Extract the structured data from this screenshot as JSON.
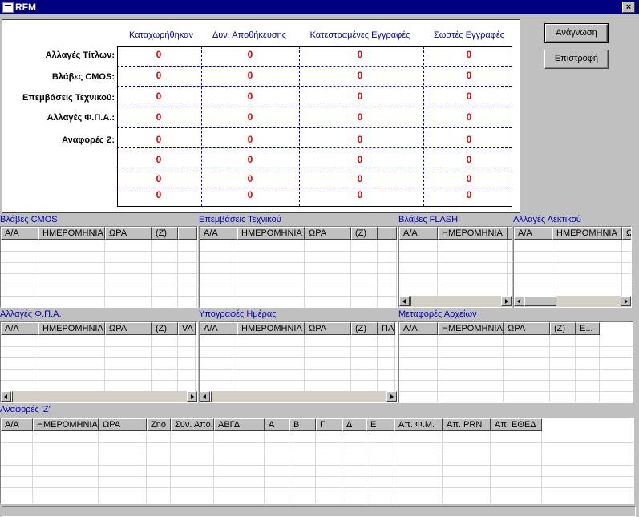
{
  "window": {
    "title": "RFM",
    "close_label": "×"
  },
  "summary": {
    "columns": [
      "Καταχωρήθηκαν",
      "Δυν. Αποθήκευσης",
      "Κατεστραμένες Εγγραφές",
      "Σωστές Εγγραφές"
    ],
    "row_labels": [
      "Αλλαγές Τίτλων:",
      "Βλάβες CMOS:",
      "Επεμβάσεις Τεχνικού:",
      "Αλλαγές Φ.Π.Α.:",
      "Αναφορές Ζ:"
    ],
    "values": [
      [
        "0",
        "0",
        "0",
        "0"
      ],
      [
        "0",
        "0",
        "0",
        "0"
      ],
      [
        "0",
        "0",
        "0",
        "0"
      ],
      [
        "0",
        "0",
        "0",
        "0"
      ],
      [
        "0",
        "0",
        "0",
        "0"
      ],
      [
        "0",
        "0",
        "0",
        "0"
      ],
      [
        "0",
        "0",
        "0",
        "0"
      ],
      [
        "0",
        "0",
        "0",
        "0"
      ]
    ]
  },
  "buttons": {
    "read": "Ανάγνωση",
    "back": "Επιστροφή"
  },
  "grids": {
    "cmos": {
      "label": "Βλάβες CMOS",
      "columns": [
        "Α/Α",
        "ΗΜΕΡΟΜΗΝΙΑ",
        "ΩΡΑ",
        "(Ζ)",
        ""
      ]
    },
    "technician": {
      "label": "Επεμβάσεις Τεχνικού",
      "columns": [
        "Α/Α",
        "ΗΜΕΡΟΜΗΝΙΑ",
        "ΩΡΑ",
        "(Ζ)",
        ""
      ]
    },
    "flash": {
      "label": "Βλάβες FLASH",
      "columns": [
        "Α/Α",
        "ΗΜΕΡΟΜΗΝΙΑ",
        "Ω"
      ]
    },
    "lexicon": {
      "label": "Αλλαγές Λεκτικού",
      "columns": [
        "Α/Α",
        "ΗΜΕΡΟΜΗΝΙΑ",
        "Ω"
      ]
    },
    "vat": {
      "label": "Αλλαγές Φ.Π.Α.",
      "columns": [
        "Α/Α",
        "ΗΜΕΡΟΜΗΝΙΑ",
        "ΩΡΑ",
        "(Ζ)",
        "VA"
      ]
    },
    "signatures": {
      "label": "Υπογραφές Ημέρας",
      "columns": [
        "Α/Α",
        "ΗΜΕΡΟΜΗΝΙΑ",
        "ΩΡΑ",
        "(Ζ)",
        "ΠΑ"
      ]
    },
    "transfers": {
      "label": "Μεταφορές Αρχείων",
      "columns": [
        "Α/Α",
        "ΗΜΕΡΟΜΗΝΙΑ",
        "ΩΡΑ",
        "(Ζ)",
        "Ε..."
      ]
    },
    "zreports": {
      "label": "Αναφορές 'Ζ'",
      "columns": [
        "Α/Α",
        "ΗΜΕΡΟΜΗΝΙΑ",
        "ΩΡΑ",
        "Zno",
        "Συν. Απο...",
        "ΑΒΓΔ",
        "Α",
        "Β",
        "Γ",
        "Δ",
        "Ε",
        "Απ. Φ.Μ.",
        "Απ. PRN",
        "Απ. ΕΘΕΔ"
      ]
    }
  }
}
